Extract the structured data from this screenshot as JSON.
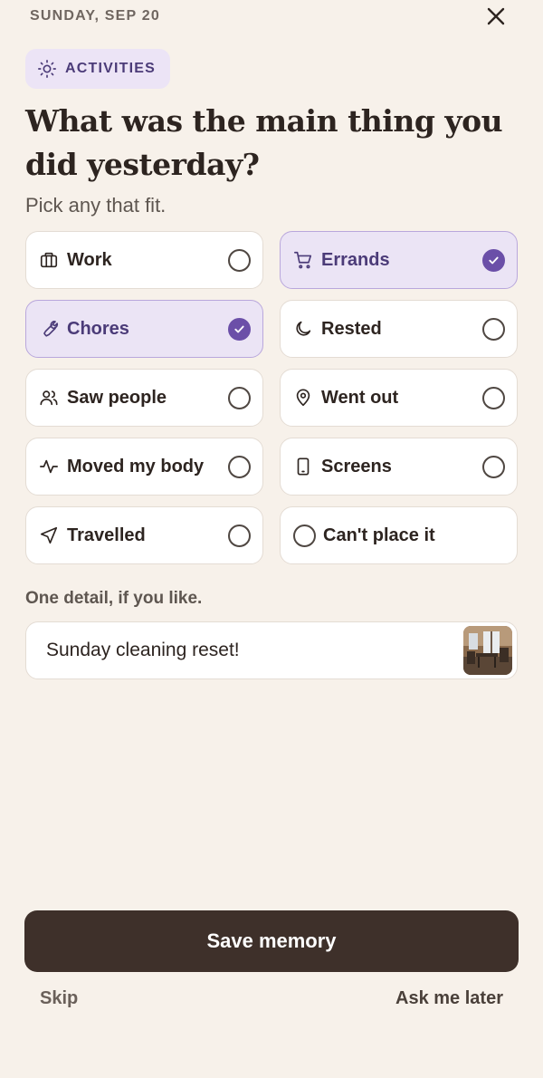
{
  "header": {
    "date": "SUNDAY, SEP 20",
    "close_icon": "close-icon"
  },
  "category_pill": {
    "icon": "sun-icon",
    "label": "ACTIVITIES"
  },
  "question": {
    "title": "What was the main thing you did yesterday?",
    "hint": "Pick any that fit."
  },
  "options": [
    {
      "label": "Work",
      "icon": "briefcase-icon",
      "selected": false
    },
    {
      "label": "Errands",
      "icon": "cart-icon",
      "selected": true
    },
    {
      "label": "Chores",
      "icon": "wrench-icon",
      "selected": true
    },
    {
      "label": "Rested",
      "icon": "moon-icon",
      "selected": false
    },
    {
      "label": "Saw people",
      "icon": "people-icon",
      "selected": false
    },
    {
      "label": "Went out",
      "icon": "map-pin-icon",
      "selected": false
    },
    {
      "label": "Moved my body",
      "icon": "activity-icon",
      "selected": false
    },
    {
      "label": "Screens",
      "icon": "phone-icon",
      "selected": false
    },
    {
      "label": "Travelled",
      "icon": "navigation-icon",
      "selected": false
    },
    {
      "label": "Can't place it",
      "icon": "circle-icon",
      "selected": false
    }
  ],
  "detail": {
    "label": "One detail, if you like.",
    "value": "Sunday cleaning reset!",
    "photo": "room-photo-thumbnail"
  },
  "footer": {
    "save_label": "Save memory",
    "skip_label": "Skip",
    "later_label": "Ask me later"
  },
  "colors": {
    "background": "#f7f1ea",
    "accent": "#6b4fa8",
    "selected_bg": "#ebe4f5",
    "primary_button": "#3e302a"
  }
}
